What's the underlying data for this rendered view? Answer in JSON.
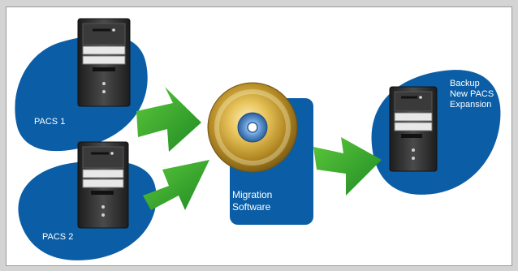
{
  "diagram": {
    "nodes": {
      "pacs1": {
        "label": "PACS 1",
        "icon": "server-tower-icon"
      },
      "pacs2": {
        "label": "PACS 2",
        "icon": "server-tower-icon"
      },
      "migration": {
        "label": "Migration\nSoftware",
        "icon": "cd-disc-icon"
      },
      "backup": {
        "label": "Backup\nNew PACS\nExpansion",
        "icon": "server-tower-icon"
      }
    },
    "edges": [
      {
        "from": "pacs1",
        "to": "migration"
      },
      {
        "from": "pacs2",
        "to": "migration"
      },
      {
        "from": "migration",
        "to": "backup"
      }
    ]
  },
  "colors": {
    "blob_blue": "#0b5ea6",
    "arrow_green": "#2ea52a",
    "server_dark": "#2c2c2c",
    "server_light": "#e8e8e8",
    "disc_gold": "#c8a43a",
    "background": "#d4d4d4"
  }
}
